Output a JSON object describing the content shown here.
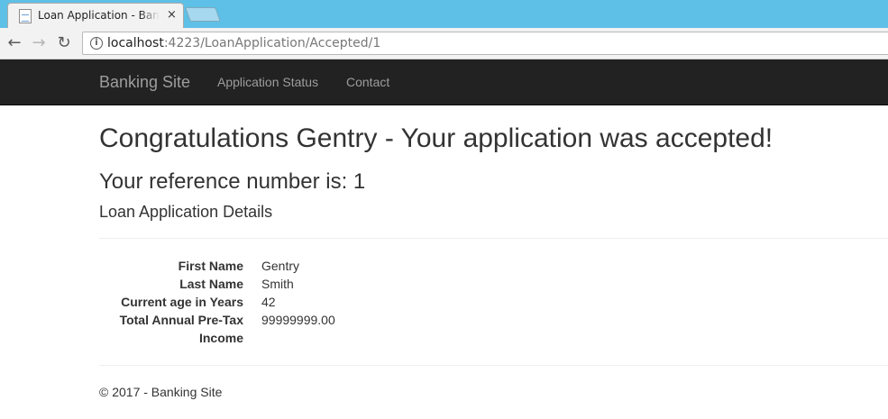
{
  "browser": {
    "tab_title": "Loan Application - Banking Site",
    "tab_close": "×",
    "back_glyph": "←",
    "forward_glyph": "→",
    "reload_glyph": "↻",
    "info_glyph": "i",
    "url_host": "localhost",
    "url_rest": ":4223/LoanApplication/Accepted/1"
  },
  "navbar": {
    "brand": "Banking Site",
    "links": [
      "Application Status",
      "Contact"
    ]
  },
  "page": {
    "heading": "Congratulations Gentry - Your application was accepted!",
    "reference": "Your reference number is: 1",
    "details_title": "Loan Application Details",
    "details": [
      {
        "label": "First Name",
        "value": "Gentry"
      },
      {
        "label": "Last Name",
        "value": "Smith"
      },
      {
        "label": "Current age in Years",
        "value": "42"
      },
      {
        "label": "Total Annual Pre-Tax",
        "value": "99999999.00"
      },
      {
        "label": "Income",
        "value": ""
      }
    ]
  },
  "footer": {
    "text": "© 2017 - Banking Site"
  },
  "colors": {
    "tabstrip": "#5ec0e6",
    "navbar": "#222222",
    "nav_text": "#9d9d9d"
  }
}
